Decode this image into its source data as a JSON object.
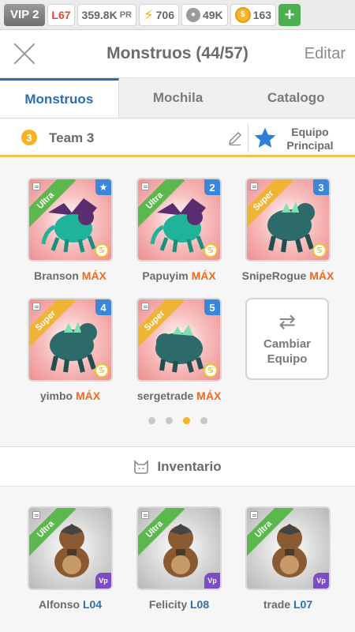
{
  "status_bar": {
    "vip": "VIP 2",
    "level": "L67",
    "power": "359.8K",
    "power_suffix": "PR",
    "energy": "706",
    "food": "49K",
    "coins": "163"
  },
  "header": {
    "title": "Monstruos (44/57)",
    "edit_label": "Editar"
  },
  "tabs": [
    {
      "label": "Monstruos",
      "active": true
    },
    {
      "label": "Mochila",
      "active": false
    },
    {
      "label": "Catalogo",
      "active": false
    }
  ],
  "team": {
    "number": "3",
    "name": "Team 3",
    "primary_label_line1": "Equipo",
    "primary_label_line2": "Principal"
  },
  "team_monsters": [
    {
      "name": "Branson",
      "tag": "MÁX",
      "rarity": "Ultra",
      "badge": "★",
      "color": "#1fb39a"
    },
    {
      "name": "Papuyim",
      "tag": "MÁX",
      "rarity": "Ultra",
      "badge": "2",
      "color": "#1fb39a"
    },
    {
      "name": "SnipeRogue",
      "tag": "MÁX",
      "rarity": "Super",
      "badge": "3",
      "color": "#2d6a6a"
    },
    {
      "name": "yimbo",
      "tag": "MÁX",
      "rarity": "Super",
      "badge": "4",
      "color": "#2d6a6a"
    },
    {
      "name": "sergetrade",
      "tag": "MÁX",
      "rarity": "Super",
      "badge": "5",
      "color": "#2d6a6a"
    }
  ],
  "swap_button": {
    "line1": "Cambiar",
    "line2": "Equipo"
  },
  "pagination": {
    "total": 4,
    "active": 3
  },
  "inventory": {
    "title": "Inventario",
    "items": [
      {
        "name": "Alfonso",
        "level": "L04",
        "rarity": "Ultra"
      },
      {
        "name": "Felicity",
        "level": "L08",
        "rarity": "Ultra"
      },
      {
        "name": "trade",
        "level": "L07",
        "rarity": "Ultra"
      }
    ]
  }
}
